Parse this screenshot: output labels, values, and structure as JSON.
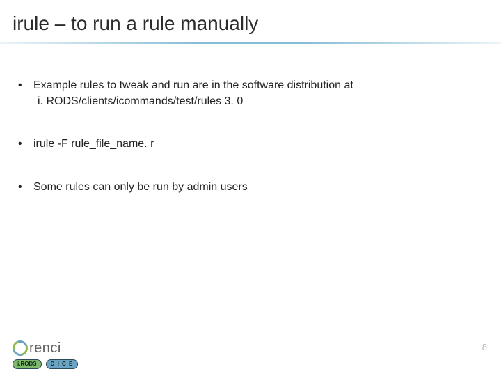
{
  "title": "irule – to run a rule manually",
  "bullets": [
    {
      "line1": "Example rules to tweak and run are in the software distribution at",
      "line2": "i. RODS/clients/icommands/test/rules 3. 0"
    },
    {
      "line1": "irule  -F rule_file_name. r"
    },
    {
      "line1": "Some rules can only be run by admin users"
    }
  ],
  "footer": {
    "page_number": "8",
    "renci_text": "renci",
    "badge_irods": "i.RODS",
    "badge_dice": "D I C E"
  }
}
